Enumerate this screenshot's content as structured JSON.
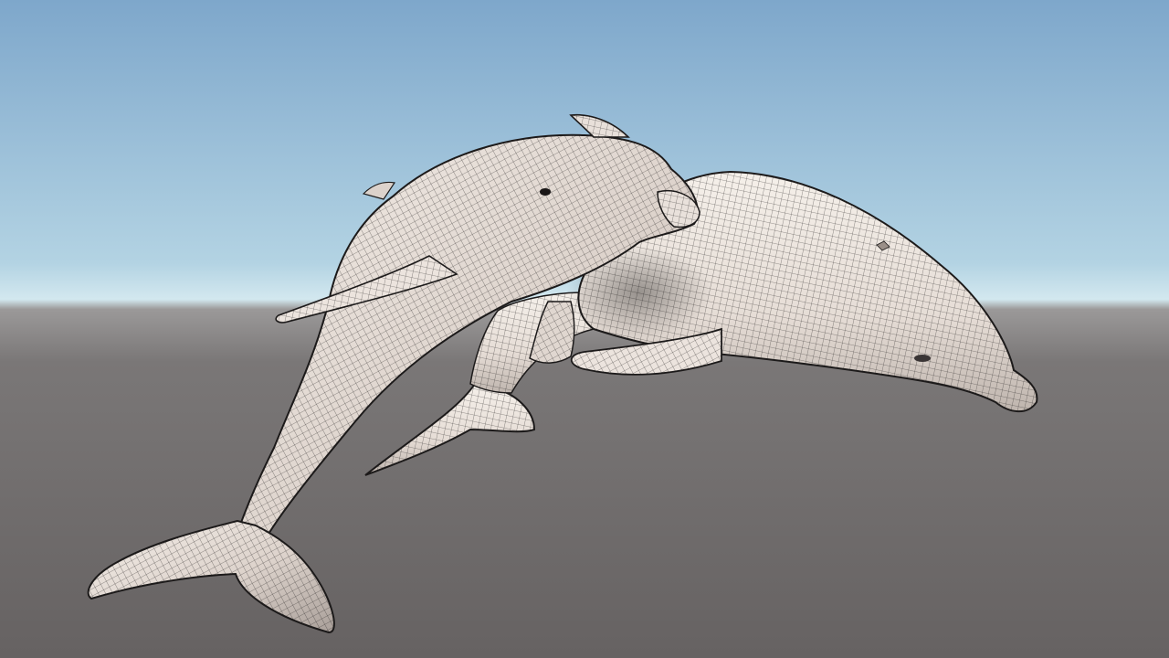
{
  "scene": {
    "colors": {
      "sky_top": "#7ea7cb",
      "sky_horizon": "#cfe6ef",
      "ground_top": "#8a8686",
      "ground": "#6b6868",
      "skin_light": "#efe8e2",
      "skin_shadow": "#b8aea8",
      "wire": "#1c1a1a"
    },
    "objects": [
      {
        "name": "front-dolphin",
        "render_style": "wireframe-mesh"
      },
      {
        "name": "back-dolphin",
        "render_style": "wireframe-mesh"
      }
    ]
  }
}
